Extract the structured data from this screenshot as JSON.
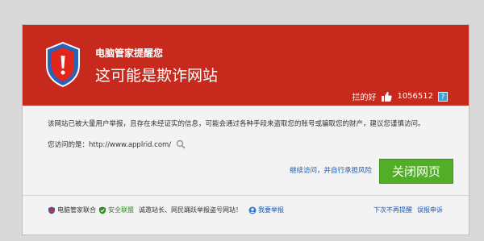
{
  "header": {
    "brand": "电脑管家提醒您",
    "headline": "这可能是欺诈网站",
    "likes_label": "拦的好",
    "likes_count": "1056512",
    "info_icon": "question-icon"
  },
  "body": {
    "warning": "该网站已被大量用户举报，且存在未经证实的信息，可能会通过各种手段来盗取您的账号或骗取您的财产，建议您谨慎访问。",
    "url_label": "您访问的是：",
    "url": "http://www.applrid.com/",
    "continue_link": "继续访问，并自行承担风险",
    "close_button": "关闭网页"
  },
  "footer": {
    "org1": "电脑管家联合",
    "org2": "安全联盟",
    "thanks": "诚邀站长、网民踊跃举报盗号网站！",
    "report_link": "我要举报",
    "no_show": "下次不再提醒",
    "feedback": "误报申诉"
  },
  "colors": {
    "header_red": "#c8291d",
    "button_green": "#52ad27",
    "link_blue": "#1a58b3"
  }
}
